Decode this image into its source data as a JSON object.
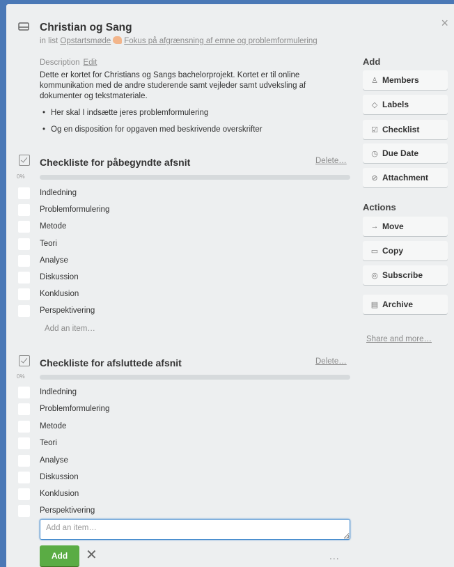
{
  "card": {
    "title": "Christian og Sang",
    "in_list_prefix": "in list",
    "list_name_part1": "Opstartsmøde",
    "list_name_part2": "Fokus på afgrænsning af emne og problemformulering",
    "description_label": "Description",
    "description_edit": "Edit",
    "description_text": "Dette er kortet for Christians og Sangs bachelorprojekt. Kortet er til online kommunikation med de andre studerende samt vejleder samt udveksling af dokumenter og tekstmateriale.",
    "bullets": [
      "Her skal I indsætte jeres problemformulering",
      "Og en disposition for opgaven med beskrivende overskrifter"
    ],
    "close_icon": "×"
  },
  "checklists": [
    {
      "title": "Checkliste for påbegyndte afsnit",
      "delete": "Delete…",
      "progress_label": "0%",
      "progress": 0,
      "items": [
        "Indledning",
        "Problemformulering",
        "Metode",
        "Teori",
        "Analyse",
        "Diskussion",
        "Konklusion",
        "Perspektivering"
      ],
      "add_item": "Add an item…"
    },
    {
      "title": "Checkliste for afsluttede afsnit",
      "delete": "Delete…",
      "progress_label": "0%",
      "progress": 0,
      "items": [
        "Indledning",
        "Problemformulering",
        "Metode",
        "Teori",
        "Analyse",
        "Diskussion",
        "Konklusion",
        "Perspektivering"
      ],
      "add_placeholder": "Add an item…",
      "add_button": "Add",
      "cancel_icon": "✕",
      "more_icon": "..."
    }
  ],
  "sidebar": {
    "add_heading": "Add",
    "add_buttons": [
      {
        "icon": "person-icon",
        "glyph": "♙",
        "label": "Members"
      },
      {
        "icon": "tag-icon",
        "glyph": "◇",
        "label": "Labels"
      },
      {
        "icon": "checklist-icon",
        "glyph": "☑",
        "label": "Checklist"
      },
      {
        "icon": "clock-icon",
        "glyph": "◷",
        "label": "Due Date"
      },
      {
        "icon": "paperclip-icon",
        "glyph": "⊘",
        "label": "Attachment"
      }
    ],
    "actions_heading": "Actions",
    "action_buttons": [
      {
        "icon": "arrow-right-icon",
        "glyph": "→",
        "label": "Move"
      },
      {
        "icon": "card-icon",
        "glyph": "▭",
        "label": "Copy"
      },
      {
        "icon": "eye-icon",
        "glyph": "◎",
        "label": "Subscribe"
      },
      {
        "icon": "archive-icon",
        "glyph": "▤",
        "label": "Archive"
      }
    ],
    "share": "Share and more…"
  },
  "colors": {
    "background": "#4a78b6",
    "card": "#edeff0",
    "add_button": "#5aac44"
  }
}
